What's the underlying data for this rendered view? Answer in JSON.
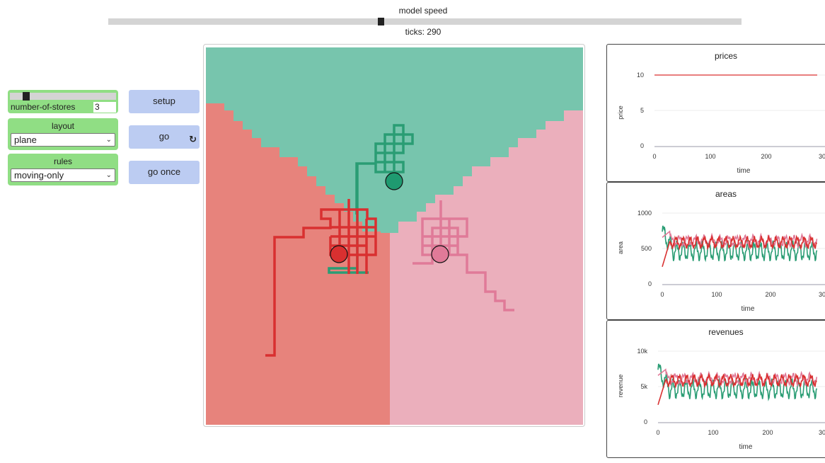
{
  "speed": {
    "label": "model speed",
    "ticks_text": "ticks: 290"
  },
  "widgets": {
    "slider": {
      "label": "number-of-stores",
      "value": "3"
    },
    "layout": {
      "title": "layout",
      "selected": "plane"
    },
    "rules": {
      "title": "rules",
      "selected": "moving-only"
    },
    "buttons": {
      "setup": "setup",
      "go": "go",
      "go_once": "go once"
    }
  },
  "colors": {
    "green": "#2a9d74",
    "red": "#d93030",
    "pink": "#e07a98",
    "button": "#bcccf2",
    "widget": "#90de84"
  },
  "plots": [
    {
      "id": "prices",
      "title": "prices",
      "ylabel": "price",
      "xlabel": "time",
      "yticks": [
        "0",
        "5",
        "10"
      ],
      "xticks": [
        "0",
        "100",
        "200",
        "30"
      ]
    },
    {
      "id": "areas",
      "title": "areas",
      "ylabel": "area",
      "xlabel": "time",
      "yticks": [
        "0",
        "500",
        "1000"
      ],
      "xticks": [
        "0",
        "100",
        "200",
        "30"
      ]
    },
    {
      "id": "revenues",
      "title": "revenues",
      "ylabel": "revenue",
      "xlabel": "time",
      "yticks": [
        "0",
        "5k",
        "10k"
      ],
      "xticks": [
        "0",
        "100",
        "200",
        "30"
      ]
    }
  ]
}
